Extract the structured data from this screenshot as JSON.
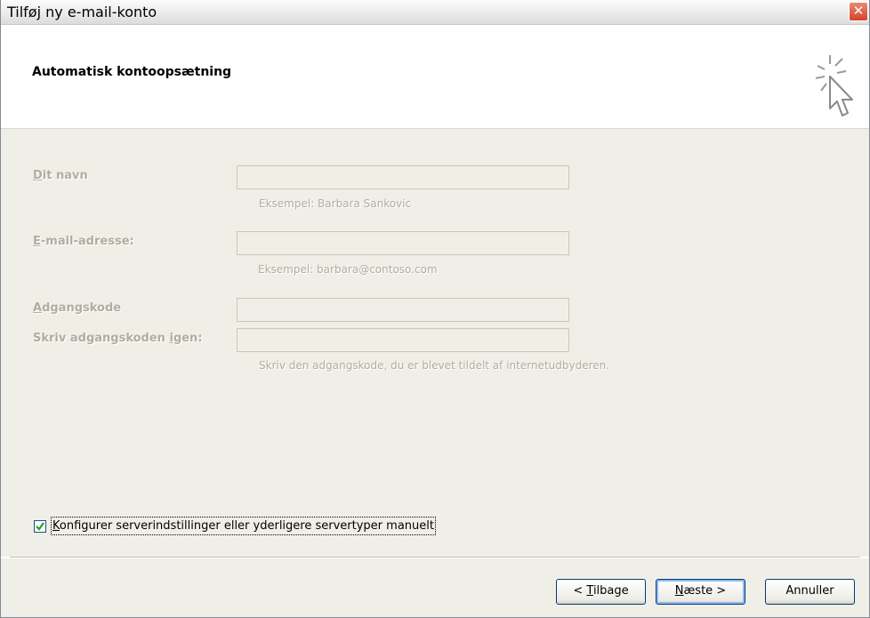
{
  "window": {
    "title": "Tilføj ny e-mail-konto",
    "close_glyph": "✕"
  },
  "header": {
    "title": "Automatisk kontoopsætning",
    "icon": "wizard-cursor-icon"
  },
  "form": {
    "name": {
      "label_key": "D",
      "label_rest": "it navn",
      "hint": "Eksempel: Barbara Sankovic",
      "value": ""
    },
    "email": {
      "label_key": "E",
      "label_rest": "-mail-adresse:",
      "hint": "Eksempel: barbara@contoso.com",
      "value": ""
    },
    "password": {
      "label_key": "A",
      "label_rest": "dgangskode",
      "value": ""
    },
    "password_confirm": {
      "label_pre": "Skriv adgangskoden ",
      "label_key": "i",
      "label_rest": "gen:",
      "value": ""
    },
    "password_hint": "Skriv den adgangskode, du er blevet tildelt af internetudbyderen."
  },
  "manual_config": {
    "checked": true,
    "label_key": "K",
    "label_rest": "onfigurer serverindstillinger eller yderligere servertyper manuelt"
  },
  "buttons": {
    "back_pre": "< ",
    "back_key": "T",
    "back_rest": "ilbage",
    "next_key": "N",
    "next_rest": "æste >",
    "cancel": "Annuller"
  }
}
